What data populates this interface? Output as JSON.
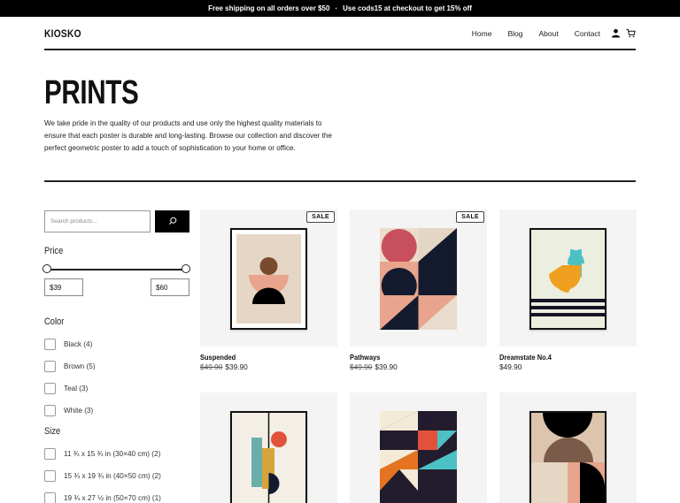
{
  "announcement": {
    "shipping": "Free shipping on all orders over $50",
    "separator": "·",
    "promo": "Use cods15 at checkout to get 15% off"
  },
  "header": {
    "logo": "KIOSKO",
    "nav": [
      "Home",
      "Blog",
      "About",
      "Contact"
    ],
    "icons": [
      "user-icon",
      "cart-icon"
    ]
  },
  "hero": {
    "title": "PRINTS",
    "description": "We take pride in the quality of our products and use only the highest quality materials to ensure that each poster is durable and long-lasting. Browse our collection and discover the perfect geometric poster to add a touch of sophistication to your home or office."
  },
  "search": {
    "placeholder": "Search products...",
    "icon": "search-icon"
  },
  "filters": {
    "price": {
      "heading": "Price",
      "min": "$39",
      "max": "$60"
    },
    "color": {
      "heading": "Color",
      "options": [
        "Black (4)",
        "Brown (5)",
        "Teal (3)",
        "White (3)"
      ]
    },
    "size": {
      "heading": "Size",
      "options": [
        "11 ¾ x 15 ¾ in (30×40 cm) (2)",
        "15 ¾ x 19 ¾ in (40×50 cm) (2)",
        "19 ¾ x 27 ½ in (50×70 cm) (1)"
      ]
    }
  },
  "products": [
    {
      "name": "Suspended",
      "badge": "SALE",
      "old_price": "$49.90",
      "price": "$39.90"
    },
    {
      "name": "Pathways",
      "badge": "SALE",
      "old_price": "$49.90",
      "price": "$39.90"
    },
    {
      "name": "Dreamstate No.4",
      "badge": "",
      "old_price": "",
      "price": "$49.90"
    },
    {
      "name": "",
      "badge": "",
      "old_price": "",
      "price": ""
    },
    {
      "name": "",
      "badge": "",
      "old_price": "",
      "price": ""
    },
    {
      "name": "",
      "badge": "",
      "old_price": "",
      "price": ""
    }
  ],
  "colors": {
    "black": "#000000",
    "terracotta": "#e8a48c",
    "navy": "#141a2e",
    "teal": "#4cc1c4",
    "orange": "#f0a020",
    "red": "#e2513a",
    "rose": "#c8505c"
  }
}
